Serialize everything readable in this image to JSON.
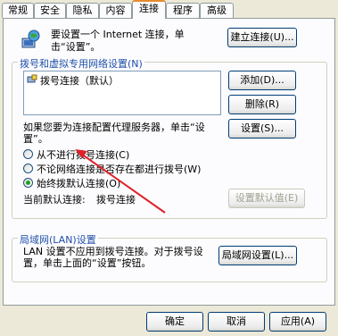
{
  "tabs": [
    "常规",
    "安全",
    "隐私",
    "内容",
    "连接",
    "程序",
    "高级"
  ],
  "setup": {
    "text": "要设置一个 Internet 连接，单击“设置”。",
    "button": "建立连接(U)..."
  },
  "dialup_group": {
    "title": "拨号和虚拟专用网络设置(N)",
    "connections": [
      "拨号连接（默认）"
    ],
    "add_button": "添加(D)...",
    "remove_button": "删除(R)",
    "proxy_text": "如果您要为连接配置代理服务器，单击“设置”。",
    "settings_button": "设置(S)...",
    "options": [
      {
        "label": "从不进行拨号连接(C)",
        "selected": false
      },
      {
        "label": "不论网络连接是否存在都进行拨号(W)",
        "selected": false
      },
      {
        "label": "始终拨默认连接(O)",
        "selected": true
      }
    ],
    "current_default_label": "当前默认连接:",
    "current_default_value": "拨号连接",
    "set_default_button": "设置默认值(E)"
  },
  "lan_group": {
    "title": "局域网(LAN)设置",
    "text": "LAN 设置不应用到拨号连接。对于拨号设置，单击上面的“设置”按钮。",
    "button": "局域网设置(L)..."
  },
  "footer": {
    "ok": "确定",
    "cancel": "取消",
    "apply": "应用(A)"
  },
  "colors": {
    "accent": "#e68b2c",
    "group_title": "#1f4fa8",
    "arrow": "#e0202a"
  }
}
